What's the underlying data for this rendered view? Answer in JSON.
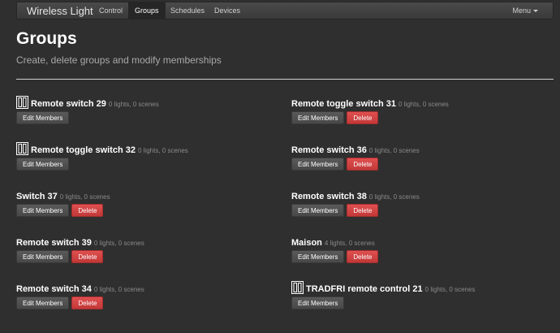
{
  "app": {
    "brand": "Wireless Light",
    "nav": [
      "Control",
      "Groups",
      "Schedules",
      "Devices"
    ],
    "menu_label": "Menu"
  },
  "page": {
    "title": "Groups",
    "subtitle": "Create, delete groups and modify memberships"
  },
  "buttons": {
    "edit_label": "Edit Members",
    "delete_label": "Delete"
  },
  "groups_left": [
    {
      "name": "Remote switch 29",
      "meta": "0 lights, 0 scenes",
      "icon": "remote-switch-icon",
      "deletable": false
    },
    {
      "name": "Remote toggle switch 32",
      "meta": "0 lights, 0 scenes",
      "icon": "remote-switch-icon",
      "deletable": false
    },
    {
      "name": "Switch 37",
      "meta": "0 lights, 0 scenes",
      "icon": "",
      "deletable": true
    },
    {
      "name": "Remote switch 39",
      "meta": "0 lights, 0 scenes",
      "icon": "",
      "deletable": true
    },
    {
      "name": "Remote switch 34",
      "meta": "0 lights, 0 scenes",
      "icon": "",
      "deletable": true
    }
  ],
  "groups_right": [
    {
      "name": "Remote toggle switch 31",
      "meta": "0 lights, 0 scenes",
      "icon": "",
      "deletable": true
    },
    {
      "name": "Remote switch 36",
      "meta": "0 lights, 0 scenes",
      "icon": "",
      "deletable": true
    },
    {
      "name": "Remote switch 38",
      "meta": "0 lights, 0 scenes",
      "icon": "",
      "deletable": true
    },
    {
      "name": "Maison",
      "meta": "4 lights, 0 scenes",
      "icon": "",
      "deletable": true
    },
    {
      "name": "TRADFRI remote control 21",
      "meta": "0 lights, 0 scenes",
      "icon": "remote-switch-icon",
      "deletable": false
    }
  ],
  "colors": {
    "background": "#2f2f2f",
    "delete": "#c9302c",
    "edit": "#4f4f4f"
  }
}
